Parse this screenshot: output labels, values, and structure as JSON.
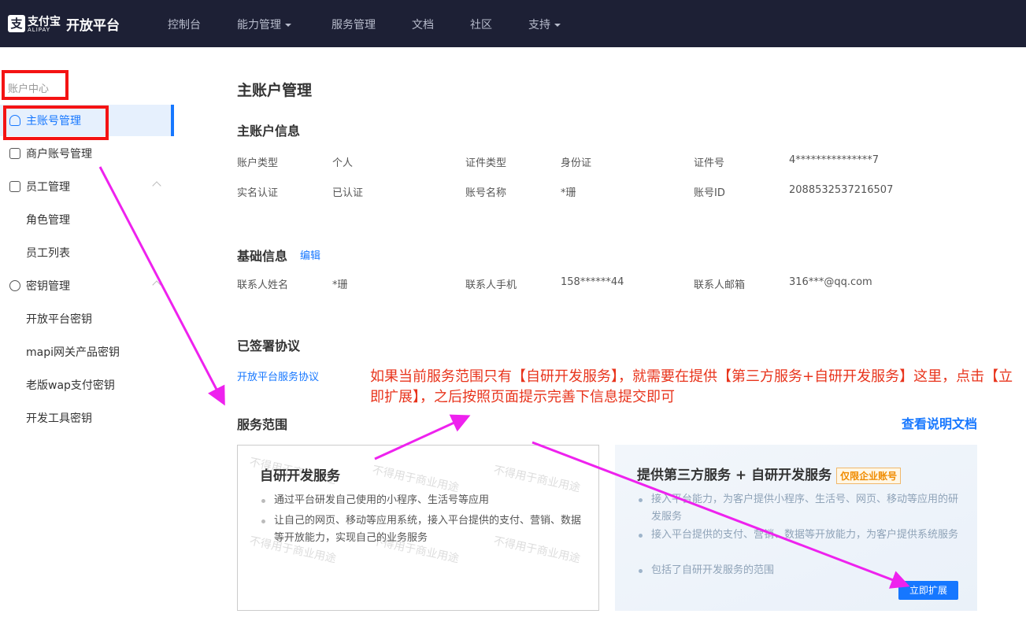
{
  "header": {
    "logo_glyph": "支",
    "logo_text": "支付宝",
    "logo_sub": "ALIPAY",
    "platform": "开放平台",
    "nav": [
      {
        "label": "控制台"
      },
      {
        "label": "能力管理"
      },
      {
        "label": "服务管理"
      },
      {
        "label": "文档"
      },
      {
        "label": "社区"
      },
      {
        "label": "支持"
      }
    ]
  },
  "sidebar": {
    "section": "账户中心",
    "items": [
      {
        "label": "主账号管理"
      },
      {
        "label": "商户账号管理"
      },
      {
        "label": "员工管理"
      },
      {
        "label": "角色管理"
      },
      {
        "label": "员工列表"
      },
      {
        "label": "密钥管理"
      },
      {
        "label": "开放平台密钥"
      },
      {
        "label": "mapi网关产品密钥"
      },
      {
        "label": "老版wap支付密钥"
      },
      {
        "label": "开发工具密钥"
      }
    ]
  },
  "main": {
    "title": "主账户管理",
    "account_info": {
      "title": "主账户信息",
      "fields": [
        {
          "label": "账户类型",
          "value": "个人"
        },
        {
          "label": "证件类型",
          "value": "身份证"
        },
        {
          "label": "证件号",
          "value": "4***************7"
        },
        {
          "label": "实名认证",
          "value": "已认证"
        },
        {
          "label": "账号名称",
          "value": "*珊"
        },
        {
          "label": "账号ID",
          "value": "2088532537216507"
        }
      ]
    },
    "basic_info": {
      "title": "基础信息",
      "edit": "编辑",
      "fields": [
        {
          "label": "联系人姓名",
          "value": "*珊"
        },
        {
          "label": "联系人手机",
          "value": "158******44"
        },
        {
          "label": "联系人邮箱",
          "value": "316***@qq.com"
        }
      ]
    },
    "agreements": {
      "title": "已签署协议",
      "link": "开放平台服务协议"
    },
    "scope": {
      "title": "服务范围",
      "doc_link": "查看说明文档",
      "watermark": "不得用于商业用途",
      "card1": {
        "title": "自研开发服务",
        "bullets": [
          "通过平台研发自己使用的小程序、生活号等应用",
          "让自己的网页、移动等应用系统，接入平台提供的支付、营销、数据等开放能力，实现自己的业务服务"
        ]
      },
      "card2": {
        "title": "提供第三方服务 + 自研开发服务",
        "tag": "仅限企业账号",
        "bullets": [
          "接入平台能力，为客户提供小程序、生活号、网页、移动等应用的研发服务",
          "接入平台提供的支付、营销、数据等开放能力，为客户提供系统服务",
          "包括了自研开发服务的范围"
        ],
        "button": "立即扩展"
      }
    }
  },
  "annotation": {
    "text": "如果当前服务范围只有【自研开发服务】，就需要在提供【第三方服务+自研开发服务】这里，点击【立即扩展】，之后按照页面提示完善下信息提交即可",
    "color": "#e8341c",
    "arrow_color": "#ee22ee"
  }
}
